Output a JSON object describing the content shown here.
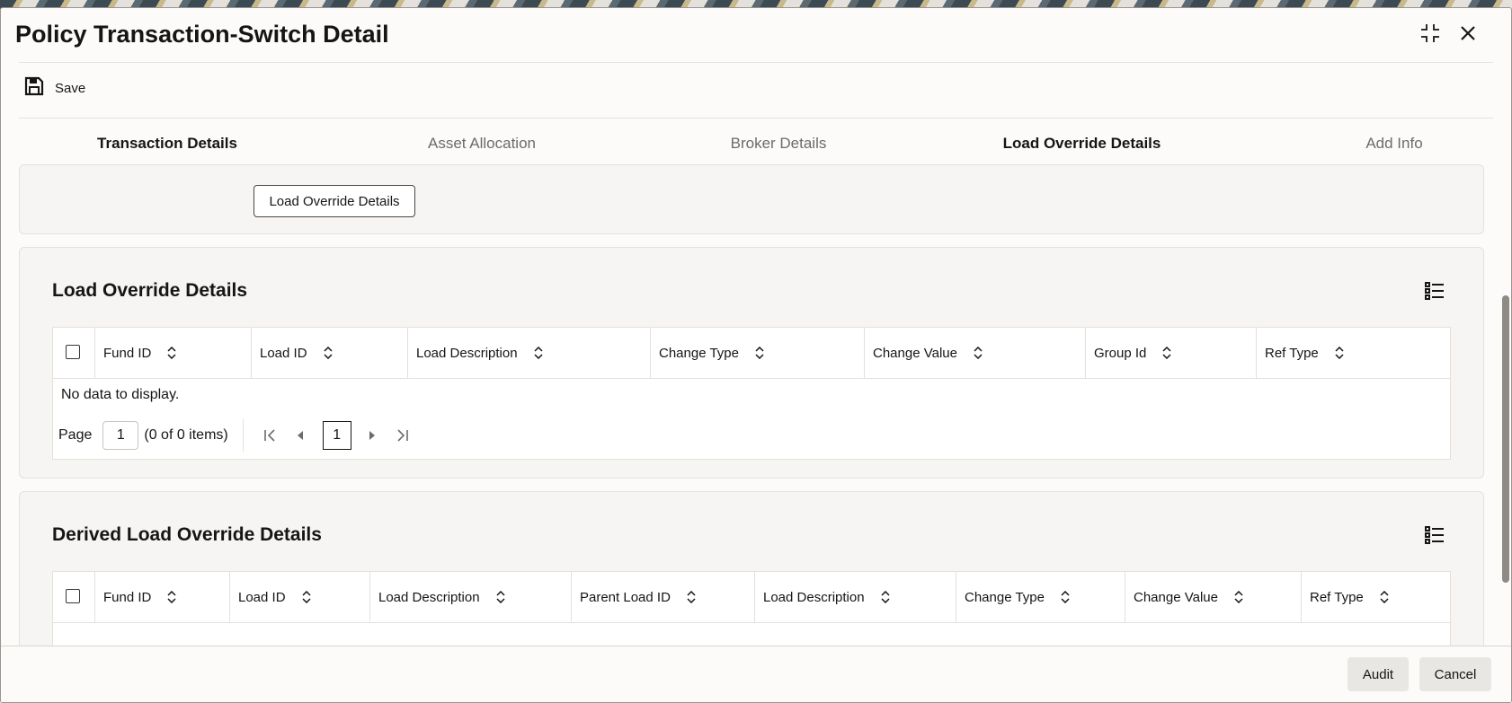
{
  "window": {
    "title": "Policy Transaction-Switch Detail"
  },
  "toolbar": {
    "save_label": "Save"
  },
  "tabs": [
    {
      "label": "Transaction Details"
    },
    {
      "label": "Asset Allocation"
    },
    {
      "label": "Broker Details"
    },
    {
      "label": "Load Override Details",
      "active": true
    },
    {
      "label": "Add Info"
    }
  ],
  "top_panel": {
    "button_label": "Load Override Details"
  },
  "load_override": {
    "title": "Load Override Details",
    "columns": [
      "Fund ID",
      "Load ID",
      "Load Description",
      "Change Type",
      "Change Value",
      "Group Id",
      "Ref Type"
    ],
    "empty_text": "No data to display.",
    "pager": {
      "page_label": "Page",
      "page_value": "1",
      "items_text": "(0 of 0 items)",
      "current_page": "1"
    }
  },
  "derived_load_override": {
    "title": "Derived Load Override Details",
    "columns": [
      "Fund ID",
      "Load ID",
      "Load Description",
      "Parent Load ID",
      "Load Description",
      "Change Type",
      "Change Value",
      "Ref Type"
    ]
  },
  "footer": {
    "audit_label": "Audit",
    "cancel_label": "Cancel"
  },
  "colors": {
    "active_tab_underline": "#51657a",
    "panel_background": "#f6f5f3",
    "text": "#161513"
  },
  "icons": [
    "save-icon",
    "maximize-icon",
    "close-icon",
    "list-view-icon",
    "sort-icon",
    "first-page-icon",
    "previous-page-icon",
    "next-page-icon",
    "last-page-icon"
  ]
}
